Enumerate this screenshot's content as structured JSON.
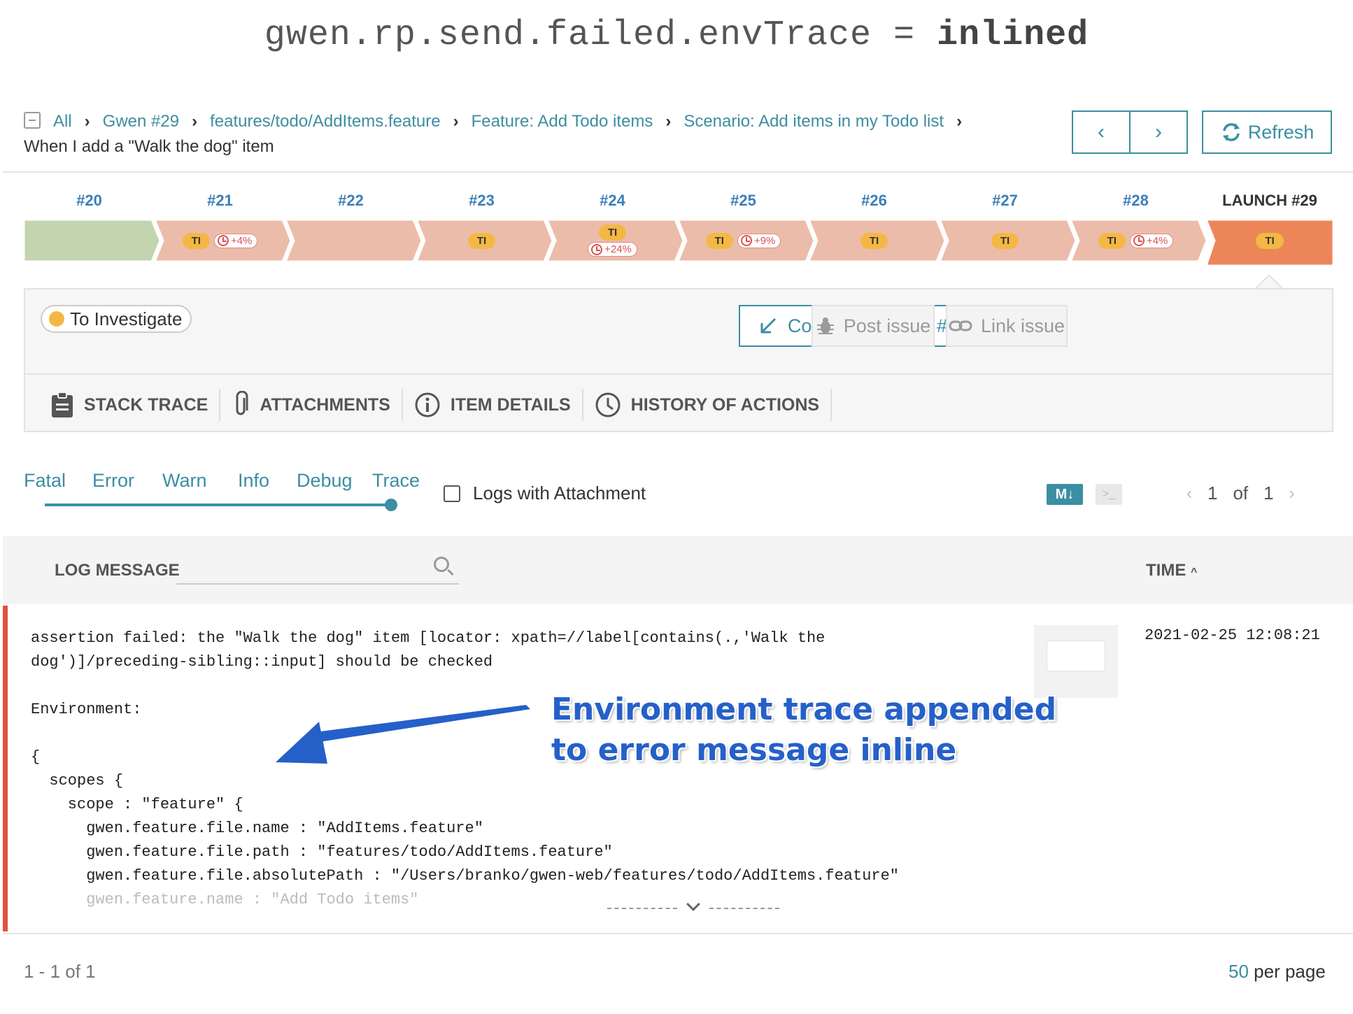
{
  "banner": {
    "prefix": "gwen.rp.send.failed.envTrace =",
    "value": "inlined"
  },
  "breadcrumb": {
    "items": [
      "All",
      "Gwen #29",
      "features/todo/AddItems.feature",
      "Feature: Add Todo items",
      "Scenario: Add items in my Todo list"
    ],
    "current": "When I add a \"Walk the dog\" item"
  },
  "nav": {
    "prev_icon": "chevron-left-icon",
    "next_icon": "chevron-right-icon",
    "refresh_label": "Refresh"
  },
  "history": [
    {
      "label": "#20",
      "status": "passed",
      "ti": "",
      "duration": ""
    },
    {
      "label": "#21",
      "status": "failed",
      "ti": "TI",
      "duration": "+4%"
    },
    {
      "label": "#22",
      "status": "failed",
      "ti": "",
      "duration": ""
    },
    {
      "label": "#23",
      "status": "failed",
      "ti": "TI",
      "duration": ""
    },
    {
      "label": "#24",
      "status": "failed",
      "ti": "TI",
      "duration": "+24%"
    },
    {
      "label": "#25",
      "status": "failed",
      "ti": "TI",
      "duration": "+9%"
    },
    {
      "label": "#26",
      "status": "failed",
      "ti": "TI",
      "duration": ""
    },
    {
      "label": "#27",
      "status": "failed",
      "ti": "TI",
      "duration": ""
    },
    {
      "label": "#28",
      "status": "failed",
      "ti": "TI",
      "duration": "+4%"
    },
    {
      "label": "LAUNCH #29",
      "status": "current",
      "ti": "TI",
      "duration": ""
    }
  ],
  "colors": {
    "accent": "#3b8ea3",
    "passed": "#c3d4b0",
    "failed": "#ecbcaa",
    "current": "#ec8658",
    "ti_badge": "#f3b844",
    "error_mark": "#e0533a",
    "annotation": "#2560c9"
  },
  "defect": {
    "status": "To Investigate",
    "copy_label": "Copy defect from #28",
    "post_label": "Post issue",
    "link_label": "Link issue"
  },
  "tabs": [
    {
      "label": "STACK TRACE",
      "icon": "clipboard-icon"
    },
    {
      "label": "ATTACHMENTS",
      "icon": "paperclip-icon"
    },
    {
      "label": "ITEM DETAILS",
      "icon": "info-icon"
    },
    {
      "label": "HISTORY OF ACTIONS",
      "icon": "clock-icon"
    }
  ],
  "log_levels": [
    "Fatal",
    "Error",
    "Warn",
    "Info",
    "Debug",
    "Trace"
  ],
  "logs_with_attachment": "Logs with Attachment",
  "view_modes": {
    "markdown": "M↓",
    "console": ">_"
  },
  "pager": {
    "current": "1",
    "of": "of",
    "total": "1"
  },
  "table": {
    "col_message": "LOG MESSAGE",
    "col_time": "TIME",
    "sort_icon": "caret-up-icon"
  },
  "log": {
    "lines": [
      "assertion failed: the \"Walk the dog\" item [locator: xpath=//label[contains(.,'Walk the",
      "dog')]/preceding-sibling::input] should be checked",
      "",
      "Environment:",
      "",
      "{",
      "  scopes {",
      "    scope : \"feature\" {",
      "      gwen.feature.file.name : \"AddItems.feature\"",
      "      gwen.feature.file.path : \"features/todo/AddItems.feature\"",
      "      gwen.feature.file.absolutePath : \"/Users/branko/gwen-web/features/todo/AddItems.feature\""
    ],
    "faded_line": "      gwen.feature.name : \"Add Todo items\"",
    "time": "2021-02-25 12:08:21"
  },
  "footer": {
    "range": "1 - 1 of 1",
    "per_page_num": "50",
    "per_page_label": "per page"
  },
  "annotation": {
    "line1": "Environment trace appended",
    "line2": "to error message inline"
  }
}
